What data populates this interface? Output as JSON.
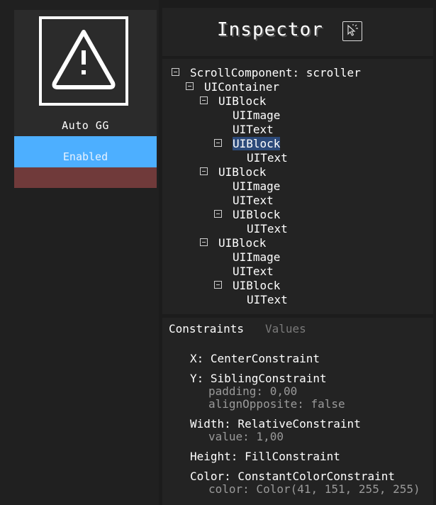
{
  "mod": {
    "name": "Auto GG",
    "status": "Enabled"
  },
  "inspector": {
    "title": "Inspector",
    "tree": [
      {
        "label": "ScrollComponent: scroller",
        "expandable": true
      },
      {
        "label": "UIContainer",
        "expandable": true
      },
      {
        "label": "UIBlock",
        "expandable": true
      },
      {
        "label": "UIImage",
        "expandable": false
      },
      {
        "label": "UIText",
        "expandable": false
      },
      {
        "label": "UIBlock",
        "expandable": true,
        "selected": true
      },
      {
        "label": "UIText",
        "expandable": false
      },
      {
        "label": "UIBlock",
        "expandable": true
      },
      {
        "label": "UIImage",
        "expandable": false
      },
      {
        "label": "UIText",
        "expandable": false
      },
      {
        "label": "UIBlock",
        "expandable": true
      },
      {
        "label": "UIText",
        "expandable": false
      },
      {
        "label": "UIBlock",
        "expandable": true
      },
      {
        "label": "UIImage",
        "expandable": false
      },
      {
        "label": "UIText",
        "expandable": false
      },
      {
        "label": "UIBlock",
        "expandable": true
      },
      {
        "label": "UIText",
        "expandable": false
      }
    ],
    "tabs": {
      "constraints": "Constraints",
      "values": "Values"
    },
    "constraints": {
      "x": "X: CenterConstraint",
      "y": "Y: SiblingConstraint",
      "y_padding": "padding: 0,00",
      "y_align": "alignOpposite: false",
      "width": "Width: RelativeConstraint",
      "width_value": "value: 1,00",
      "height": "Height: FillConstraint",
      "color": "Color: ConstantColorConstraint",
      "color_value": "color: Color(41, 151, 255, 255)"
    }
  },
  "colors": {
    "status_enabled": "#4dafff",
    "status_bar": "#703a3a",
    "selection": "#2c4a7a"
  }
}
